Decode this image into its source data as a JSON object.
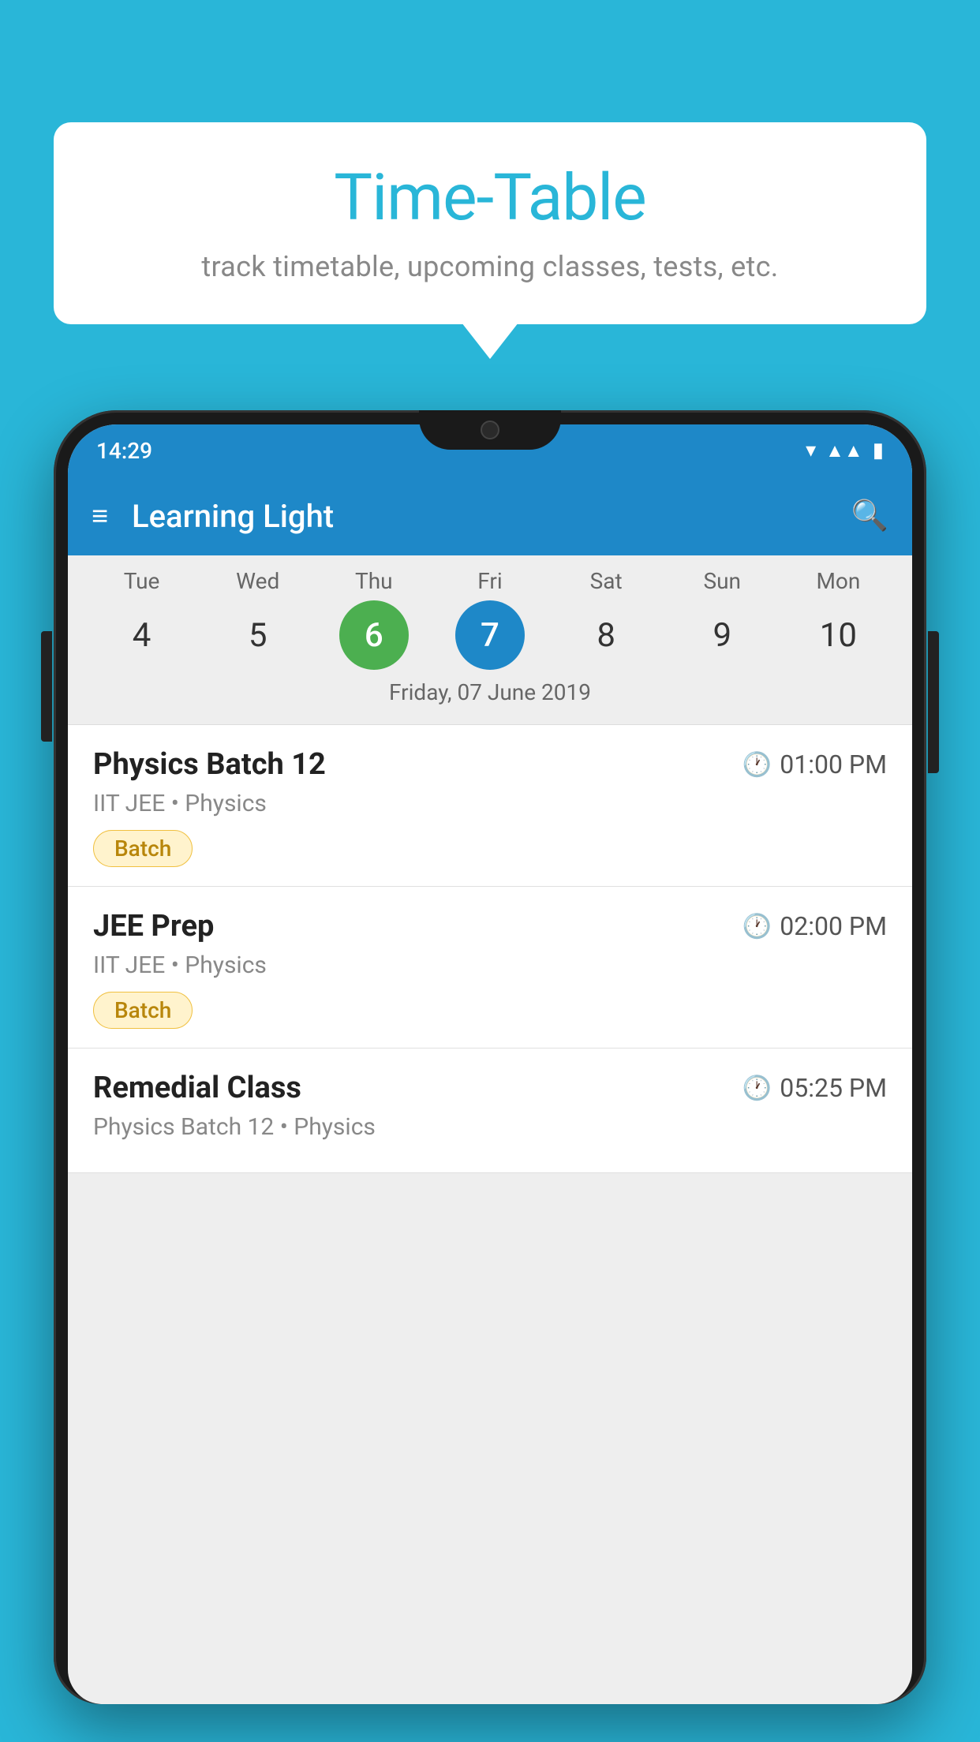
{
  "background_color": "#29b6d8",
  "speech_bubble": {
    "title": "Time-Table",
    "subtitle": "track timetable, upcoming classes, tests, etc."
  },
  "app_bar": {
    "title": "Learning Light",
    "menu_icon": "≡",
    "search_icon": "🔍"
  },
  "status_bar": {
    "time": "14:29"
  },
  "calendar": {
    "days_of_week": [
      "Tue",
      "Wed",
      "Thu",
      "Fri",
      "Sat",
      "Sun",
      "Mon"
    ],
    "dates": [
      4,
      5,
      6,
      7,
      8,
      9,
      10
    ],
    "today_index": 2,
    "selected_index": 3,
    "selected_label": "Friday, 07 June 2019"
  },
  "schedule_items": [
    {
      "title": "Physics Batch 12",
      "time": "01:00 PM",
      "subtitle": "IIT JEE • Physics",
      "badge": "Batch"
    },
    {
      "title": "JEE Prep",
      "time": "02:00 PM",
      "subtitle": "IIT JEE • Physics",
      "badge": "Batch"
    },
    {
      "title": "Remedial Class",
      "time": "05:25 PM",
      "subtitle": "Physics Batch 12 • Physics",
      "badge": ""
    }
  ]
}
